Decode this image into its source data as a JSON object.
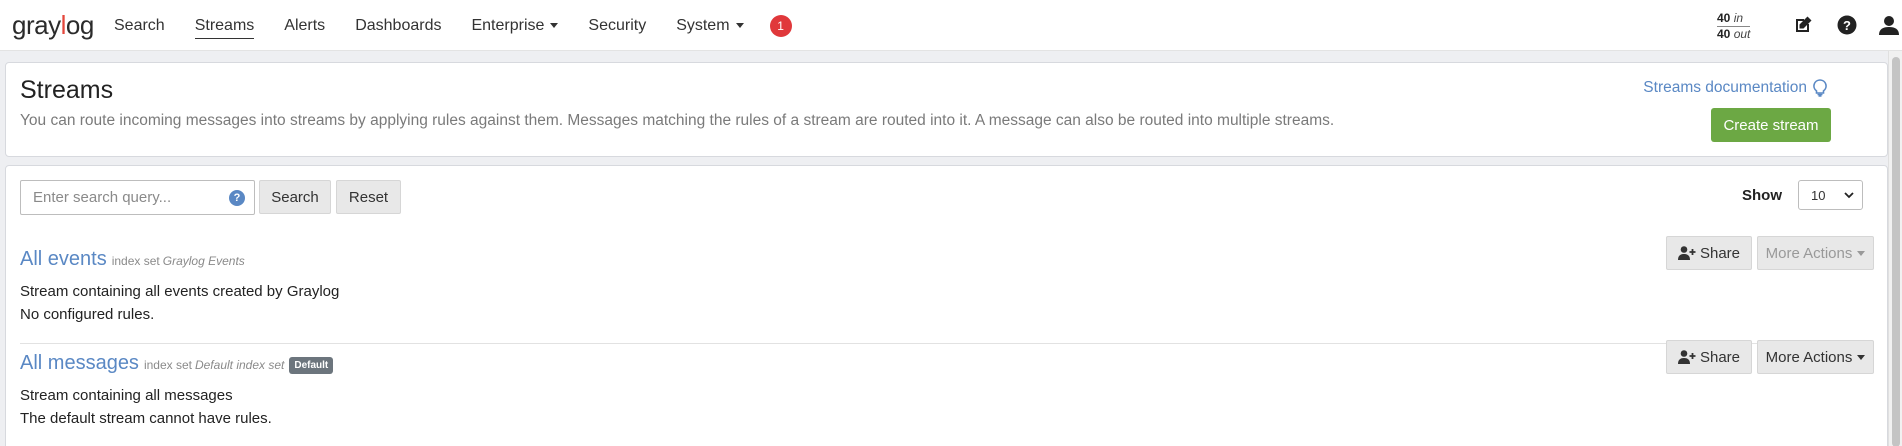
{
  "nav": {
    "logo_prefix": "gray",
    "logo_o": "l",
    "logo_suffix": "og",
    "items": [
      {
        "label": "Search"
      },
      {
        "label": "Streams"
      },
      {
        "label": "Alerts"
      },
      {
        "label": "Dashboards"
      },
      {
        "label": "Enterprise"
      },
      {
        "label": "Security"
      },
      {
        "label": "System"
      }
    ],
    "notification_count": "1",
    "throughput_in_value": "40",
    "throughput_in_label": "in",
    "throughput_out_value": "40",
    "throughput_out_label": "out",
    "icons": [
      "edit-icon",
      "help-icon",
      "user-icon"
    ]
  },
  "header": {
    "title": "Streams",
    "description": "You can route incoming messages into streams by applying rules against them. Messages matching the rules of a stream are routed into it. A message can also be routed into multiple streams.",
    "doc_link": "Streams documentation",
    "create_button": "Create stream"
  },
  "toolbar": {
    "search_placeholder": "Enter search query...",
    "help": "?",
    "search_button": "Search",
    "reset_button": "Reset",
    "show_label": "Show",
    "show_value": "10"
  },
  "streams": [
    {
      "name": "All events",
      "index_label": "index set",
      "index_name": "Graylog Events",
      "description": "Stream containing all events created by Graylog",
      "rules": "No configured rules.",
      "share_label": "Share",
      "more_label": "More Actions"
    },
    {
      "name": "All messages",
      "index_label": "index set",
      "index_name": "Default index set",
      "badge": "Default",
      "description": "Stream containing all messages",
      "rules": "The default stream cannot have rules.",
      "share_label": "Share",
      "more_label": "More Actions"
    }
  ],
  "colors": {
    "accent_blue": "#5a88c4",
    "create_green": "#6ca844",
    "badge_red": "#e0383b",
    "logo_red": "#e4473c"
  }
}
